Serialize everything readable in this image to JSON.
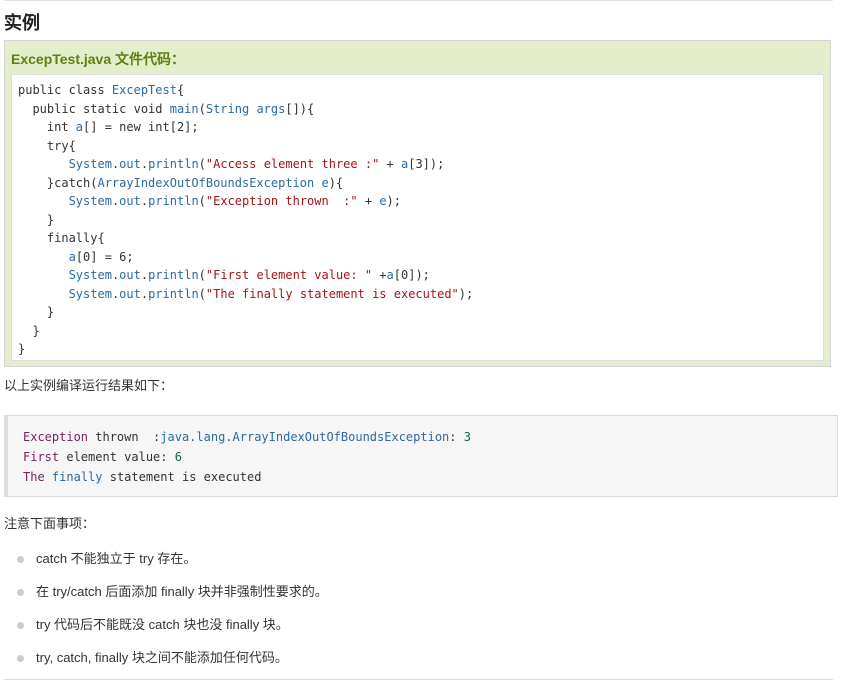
{
  "heading": "实例",
  "example": {
    "title": "ExcepTest.java 文件代码：",
    "code_lines": [
      "public class ExcepTest{",
      "  public static void main(String args[]){",
      "    int a[] = new int[2];",
      "    try{",
      "       System.out.println(\"Access element three :\" + a[3]);",
      "    }catch(ArrayIndexOutOfBoundsException e){",
      "       System.out.println(\"Exception thrown  :\" + e);",
      "    }",
      "    finally{",
      "       a[0] = 6;",
      "       System.out.println(\"First element value: \" +a[0]);",
      "       System.out.println(\"The finally statement is executed\");",
      "    }",
      "  }",
      "}"
    ]
  },
  "intro": "以上实例编译运行结果如下：",
  "output_lines": [
    "Exception thrown  :java.lang.ArrayIndexOutOfBoundsException: 3",
    "First element value: 6",
    "The finally statement is executed"
  ],
  "notes": {
    "title": "注意下面事项：",
    "items": [
      "catch 不能独立于 try 存在。",
      "在 try/catch 后面添加 finally 块并非强制性要求的。",
      "try 代码后不能既没 catch 块也没 finally 块。",
      "try, catch, finally 块之间不能添加任何代码。"
    ]
  }
}
